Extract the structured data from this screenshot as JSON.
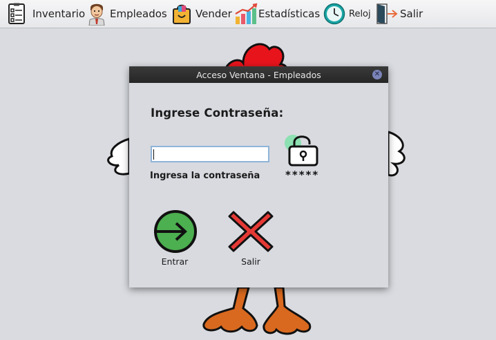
{
  "menu": {
    "items": [
      {
        "label": "Inventario",
        "icon": "checklist-icon"
      },
      {
        "label": "Empleados",
        "icon": "employee-icon"
      },
      {
        "label": "Vender",
        "icon": "shopping-bag-icon"
      },
      {
        "label": "Estadísticas",
        "icon": "bar-chart-icon"
      },
      {
        "label": "Reloj",
        "icon": "clock-icon"
      },
      {
        "label": "Salir",
        "icon": "exit-door-icon"
      }
    ]
  },
  "dialog": {
    "title": "Acceso Ventana - Empleados",
    "heading": "Ingrese Contraseña:",
    "password_value": "",
    "password_hint": "Ingresa la contraseña",
    "mask_text": "*****",
    "enter_label": "Entrar",
    "exit_label": "Salir"
  },
  "colors": {
    "enter_button": "#4caf50",
    "exit_button": "#e53935",
    "titlebar": "#2d2d2d",
    "background": "#d9dbe0"
  }
}
